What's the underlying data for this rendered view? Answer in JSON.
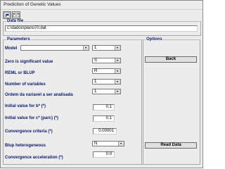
{
  "window": {
    "title": "Prediction of Genetic Values"
  },
  "toolbar": {
    "icons": [
      "run-icon",
      "mail-icon"
    ]
  },
  "data_file": {
    "legend": "Data file",
    "value": "c:\\dados\\plano70.dat"
  },
  "parameters": {
    "legend": "Parameters",
    "model": {
      "label": "Model",
      "left_value": "",
      "right_value": "1"
    },
    "zero_significant": {
      "label": "Zero is significant value",
      "value": "S"
    },
    "reml_blup": {
      "label": "REML or BLUP",
      "value": "R"
    },
    "num_variables": {
      "label": "Number of variables",
      "value": "1"
    },
    "ordem_variavel": {
      "label": "Ordem da variavel a ser analisada",
      "value": "1"
    },
    "initial_b": {
      "label": "Initial value for b* (*)",
      "value": "0.1"
    },
    "initial_c": {
      "label": "Initial value for c* (parc) (*)",
      "value": "0.1"
    },
    "convergence_criteria": {
      "label": "Convergence criteria (*)",
      "value": "0.00001"
    },
    "blup_heterogeneous": {
      "label": "Blup heterogeneous",
      "value": "N"
    },
    "convergence_acceleration": {
      "label": "Convergence acceleration (*)",
      "value": "0.0"
    }
  },
  "options": {
    "legend": "Options",
    "back_label": "Back",
    "read_data_label": "Read Data"
  }
}
